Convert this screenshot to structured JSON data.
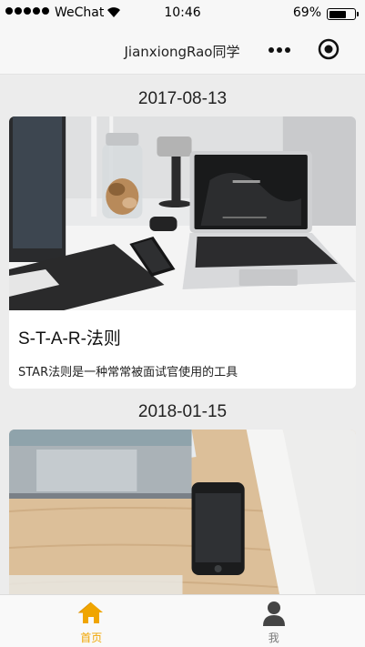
{
  "status_bar": {
    "carrier": "WeChat",
    "time": "10:46",
    "battery": "69%",
    "battery_level": 0.69
  },
  "nav": {
    "title": "JianxiongRao同学",
    "more_icon": "more-dots-icon",
    "capsule_icon": "target-circle-icon"
  },
  "posts": [
    {
      "date": "2017-08-13",
      "title": "S-T-A-R-法则",
      "description": "STAR法则是一种常常被面试官使用的工具",
      "photo": "desk-laptop-photo"
    },
    {
      "date": "2018-01-15",
      "photo": "phone-laptop-wood-photo"
    }
  ],
  "tab_bar": {
    "active_color": "#f0a500",
    "tabs": [
      {
        "label": "首页",
        "icon": "home-icon",
        "active": true
      },
      {
        "label": "我",
        "icon": "user-icon",
        "active": false
      }
    ]
  }
}
